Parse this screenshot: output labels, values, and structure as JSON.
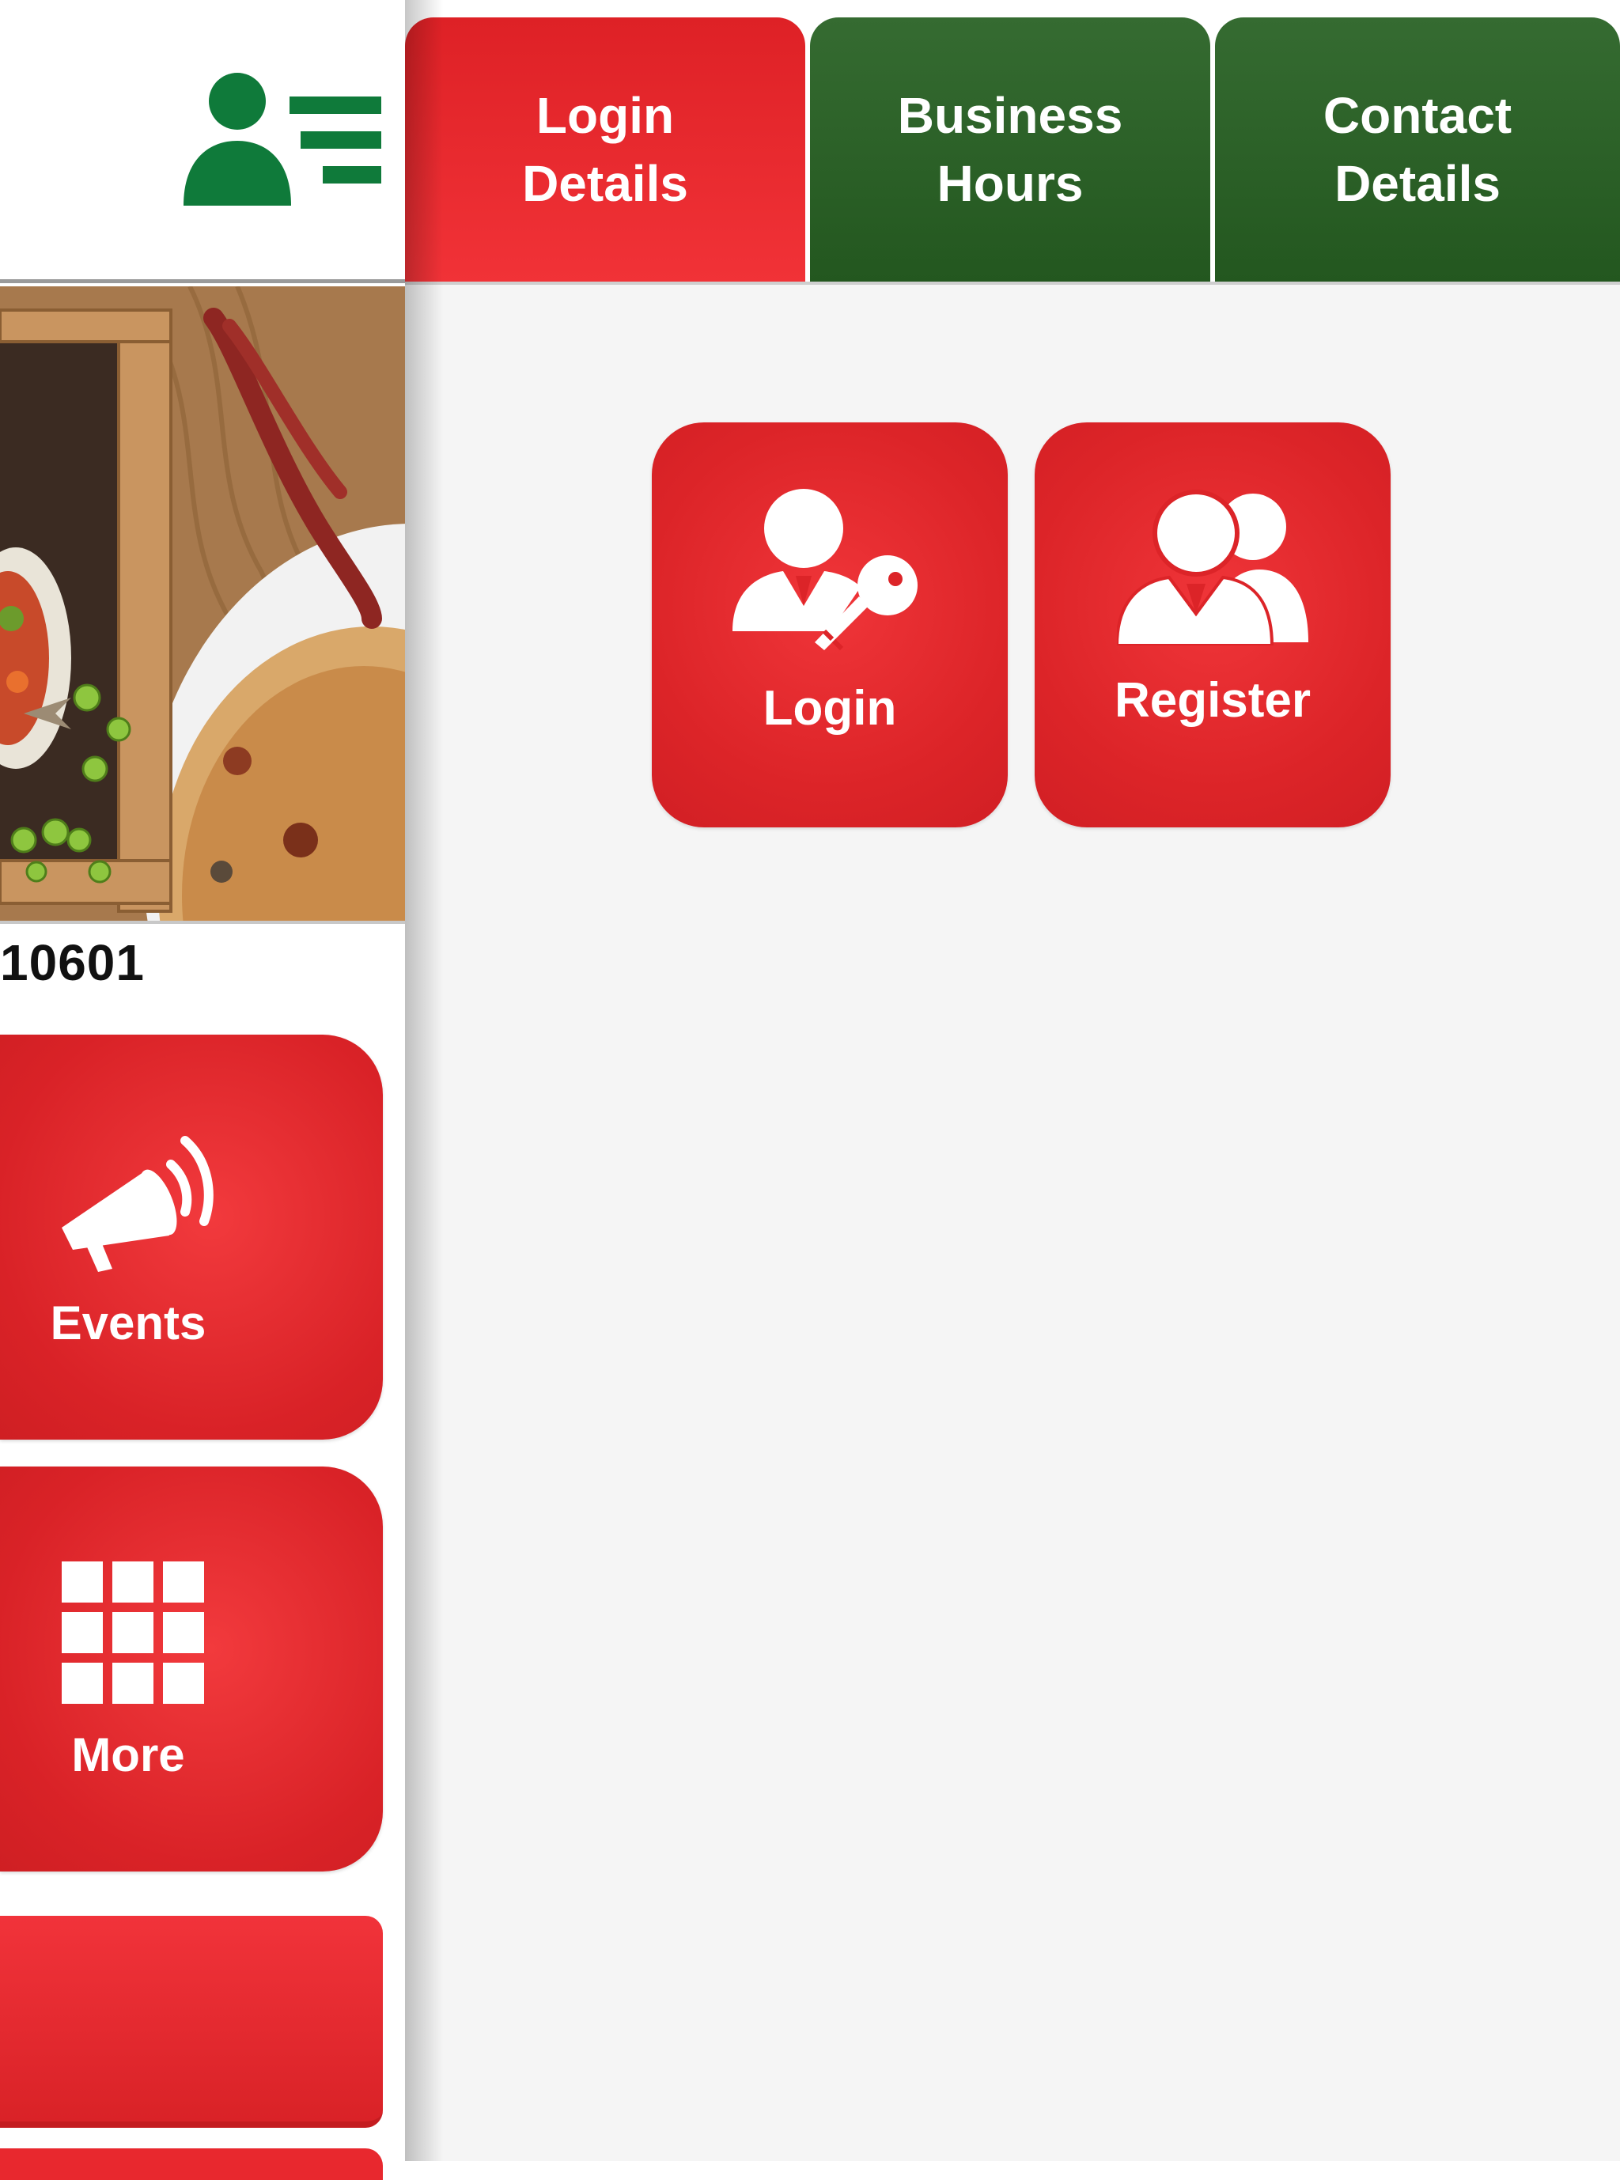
{
  "left_page": {
    "phone_fragment": "10601",
    "tiles": [
      {
        "label": "Events",
        "icon": "megaphone-icon"
      },
      {
        "label": "More",
        "icon": "grid-icon"
      }
    ]
  },
  "drawer": {
    "tabs": [
      {
        "line1": "Login",
        "line2": "Details",
        "active": true
      },
      {
        "line1": "Business",
        "line2": "Hours",
        "active": false
      },
      {
        "line1": "Contact",
        "line2": "Details",
        "active": false
      }
    ],
    "actions": {
      "login": {
        "label": "Login",
        "icon": "user-key-icon"
      },
      "register": {
        "label": "Register",
        "icon": "users-icon"
      }
    }
  },
  "colors": {
    "accent_red": "#dc2428",
    "active_tab_red": "#f13237",
    "tab_green": "#2b6127",
    "brand_green": "#0f7a3a",
    "drawer_bg": "#f5f5f5"
  }
}
